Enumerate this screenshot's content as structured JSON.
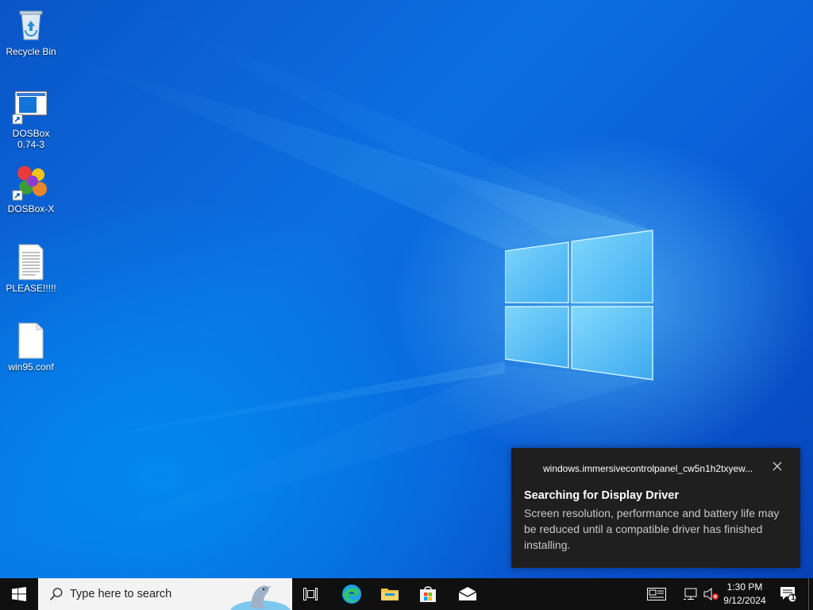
{
  "desktop": {
    "icons": [
      {
        "label": "Recycle Bin",
        "icon": "recycle-bin-icon"
      },
      {
        "label": "DOSBox 0.74-3",
        "icon": "dosbox-icon"
      },
      {
        "label": "DOSBox-X",
        "icon": "dosbox-x-icon"
      },
      {
        "label": "PLEASE!!!!!",
        "icon": "text-document-icon"
      },
      {
        "label": "win95.conf",
        "icon": "blank-file-icon"
      }
    ]
  },
  "notification": {
    "app": "windows.immersivecontrolpanel_cw5n1h2txyew...",
    "title": "Searching for Display Driver",
    "body": "Screen resolution, performance and battery life may be reduced until a compatible driver has finished installing."
  },
  "taskbar": {
    "search_placeholder": "Type here to search",
    "clock": {
      "time": "1:30 PM",
      "date": "9/12/2024"
    },
    "notification_count": "1",
    "accent": "#0078d7"
  }
}
